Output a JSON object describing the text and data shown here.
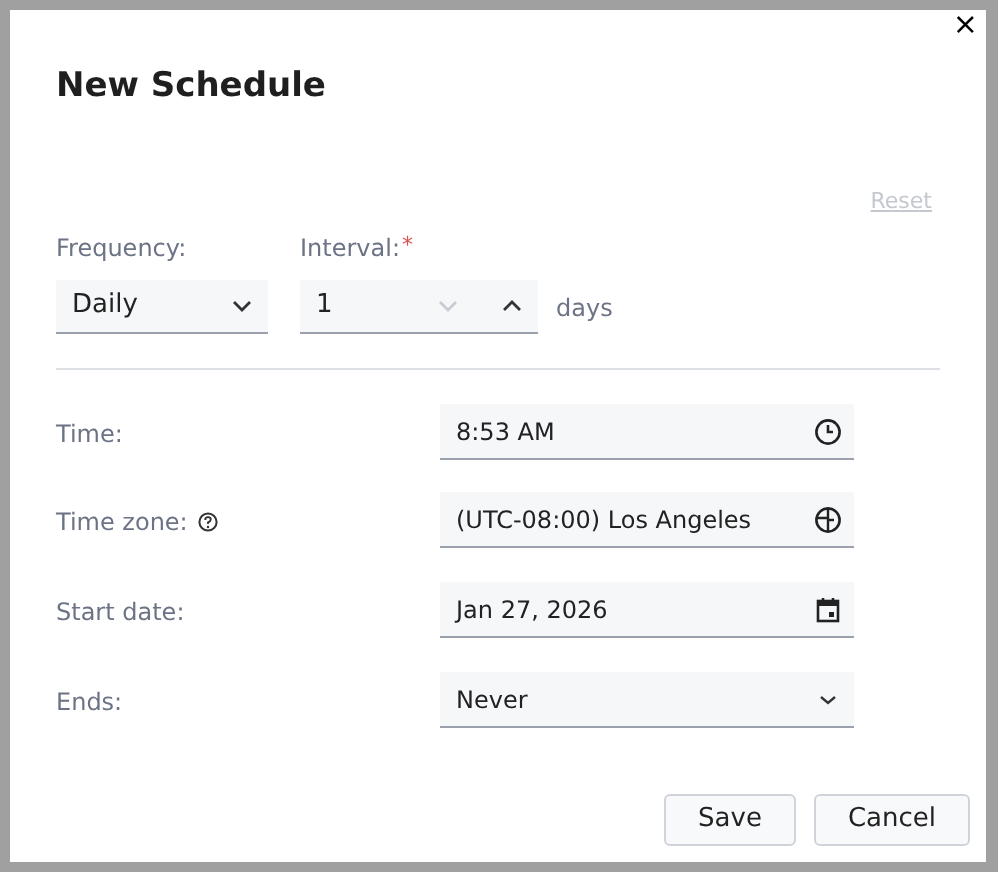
{
  "dialog": {
    "title": "New Schedule",
    "close": "×"
  },
  "reset": {
    "label": "Reset",
    "disabled": true
  },
  "frequency": {
    "label": "Frequency:",
    "value": "Daily"
  },
  "interval": {
    "label": "Interval:",
    "required_mark": "*",
    "value": "1",
    "decrement_disabled": true,
    "unit": "days"
  },
  "rows": [
    {
      "kind": "time",
      "label": "Time:",
      "value": "8:53 AM",
      "help": false
    },
    {
      "kind": "timezone",
      "label": "Time zone:",
      "value": "(UTC-08:00) Los Angeles",
      "help": true
    },
    {
      "kind": "date",
      "label": "Start date:",
      "value": "Jan 27, 2026",
      "help": false
    },
    {
      "kind": "select",
      "label": "Ends:",
      "value": "Never",
      "help": false
    }
  ],
  "buttons": [
    "Save",
    "Cancel"
  ]
}
